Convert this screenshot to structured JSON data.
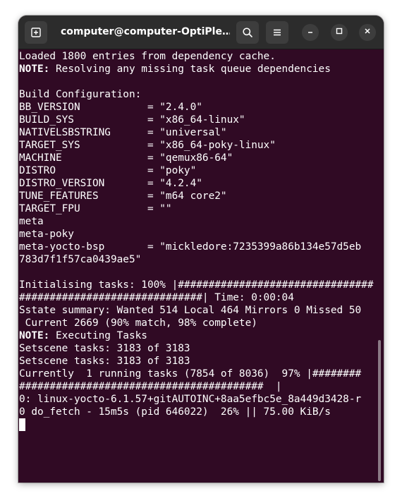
{
  "window": {
    "title": "computer@computer-OptiPle…"
  },
  "icons": {
    "new_tab": "new-tab-icon",
    "search": "search-icon",
    "menu": "hamburger-menu-icon",
    "minimize": "minimize-icon",
    "maximize": "maximize-icon",
    "close": "close-icon"
  },
  "colors": {
    "terminal_bg": "#300a24",
    "titlebar_bg": "#2c2c2c",
    "text": "#ffffff"
  },
  "terminal": {
    "lines": [
      {
        "text": "Loaded 1800 entries from dependency cache."
      },
      {
        "label": "NOTE:",
        "text": " Resolving any missing task queue dependencies"
      },
      {
        "text": ""
      },
      {
        "text": "Build Configuration:"
      },
      {
        "text": "BB_VERSION           = \"2.4.0\""
      },
      {
        "text": "BUILD_SYS            = \"x86_64-linux\""
      },
      {
        "text": "NATIVELSBSTRING      = \"universal\""
      },
      {
        "text": "TARGET_SYS           = \"x86_64-poky-linux\""
      },
      {
        "text": "MACHINE              = \"qemux86-64\""
      },
      {
        "text": "DISTRO               = \"poky\""
      },
      {
        "text": "DISTRO_VERSION       = \"4.2.4\""
      },
      {
        "text": "TUNE_FEATURES        = \"m64 core2\""
      },
      {
        "text": "TARGET_FPU           = \"\""
      },
      {
        "text": "meta"
      },
      {
        "text": "meta-poky"
      },
      {
        "text": "meta-yocto-bsp       = \"mickledore:7235399a86b134e57d5eb"
      },
      {
        "text": "783d7f1f57ca0439ae5\""
      },
      {
        "text": ""
      },
      {
        "text": "Initialising tasks: 100% |################################"
      },
      {
        "text": "##############################| Time: 0:00:04"
      },
      {
        "text": "Sstate summary: Wanted 514 Local 464 Mirrors 0 Missed 50"
      },
      {
        "text": " Current 2669 (90% match, 98% complete)"
      },
      {
        "label": "NOTE:",
        "text": " Executing Tasks"
      },
      {
        "text": "Setscene tasks: 3183 of 3183"
      },
      {
        "text": "Setscene tasks: 3183 of 3183"
      },
      {
        "text": "Currently  1 running tasks (7854 of 8036)  97% |########"
      },
      {
        "text": "########################################  |"
      },
      {
        "text": "0: linux-yocto-6.1.57+gitAUTOINC+8aa5efbc5e_8a449d3428-r"
      },
      {
        "text": "0 do_fetch - 15m5s (pid 646022)  26% || 75.00 KiB/s"
      }
    ]
  }
}
